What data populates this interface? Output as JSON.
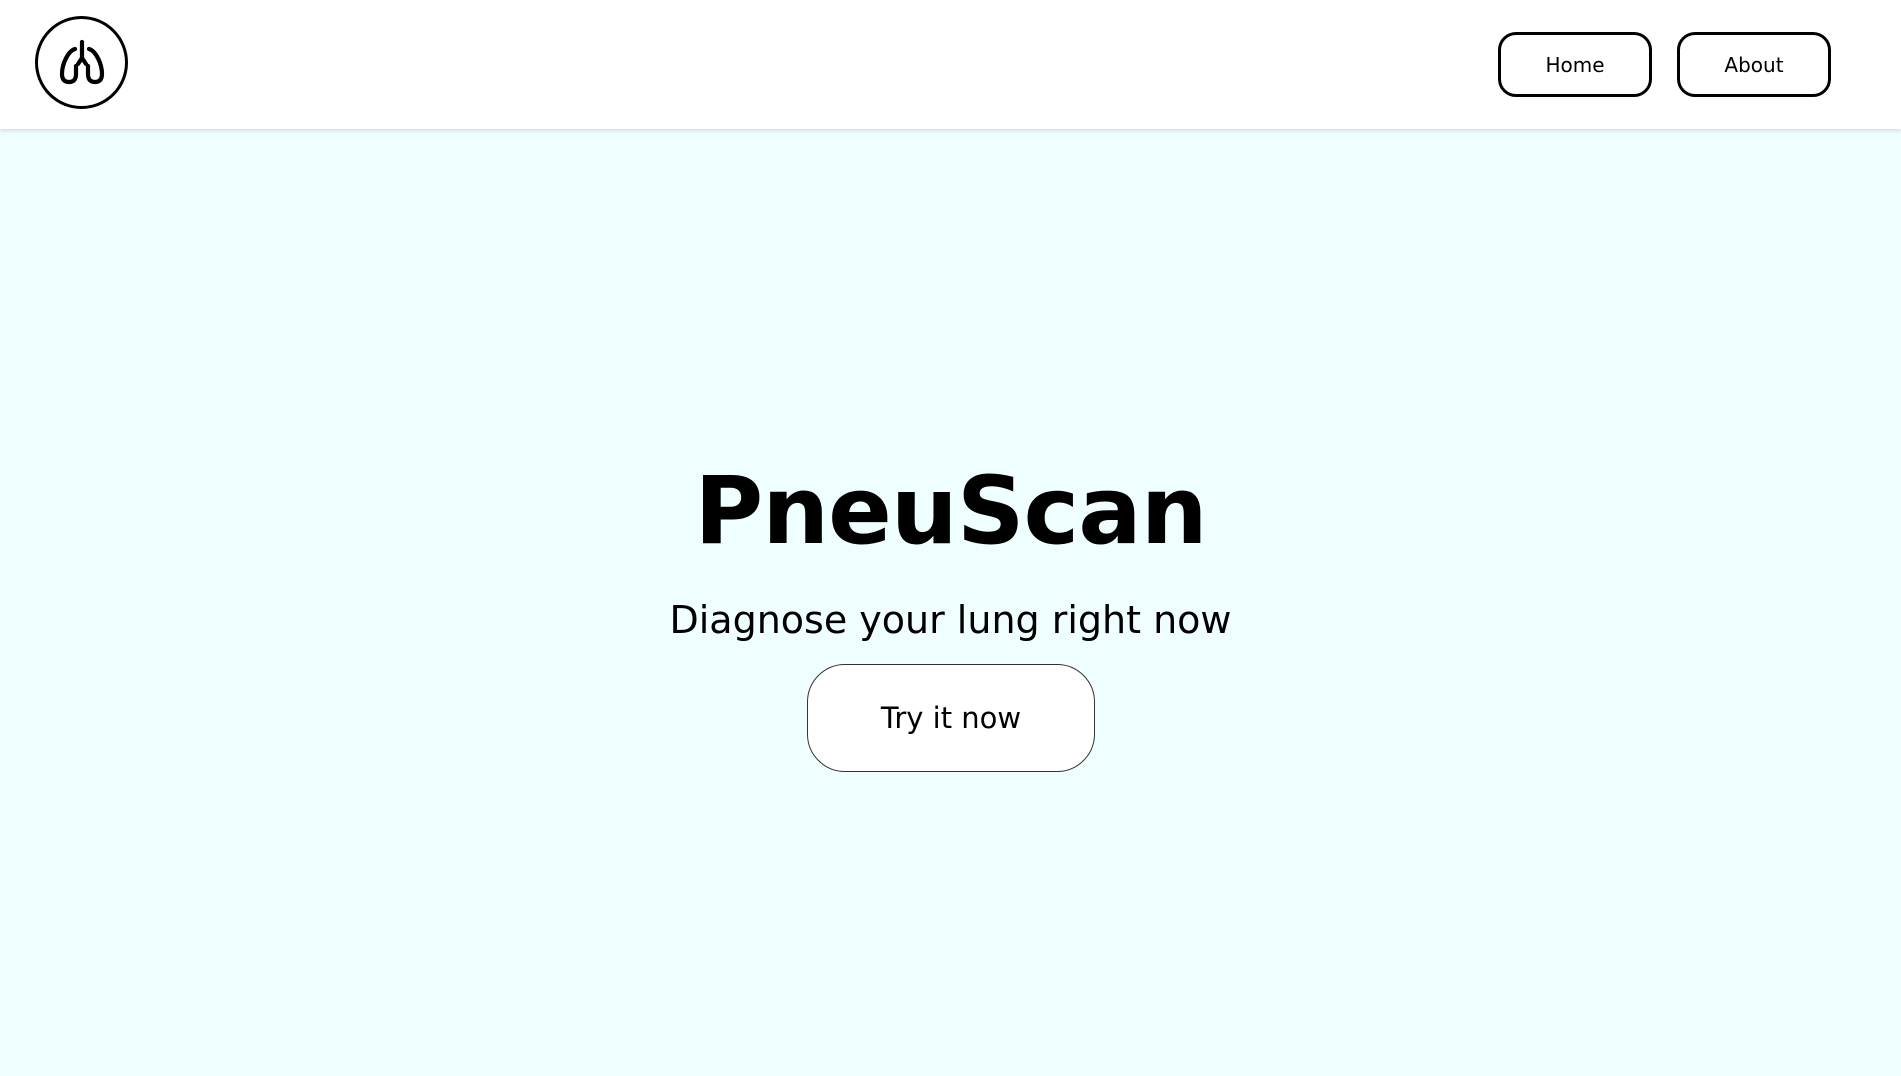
{
  "header": {
    "logo_icon": "lungs-icon",
    "nav": {
      "home_label": "Home",
      "about_label": "About"
    }
  },
  "hero": {
    "title": "PneuScan",
    "subtitle": "Diagnose your lung right now",
    "cta_label": "Try it now"
  },
  "colors": {
    "page_background": "#effefe",
    "header_background": "#ffffff",
    "border": "#000000"
  }
}
